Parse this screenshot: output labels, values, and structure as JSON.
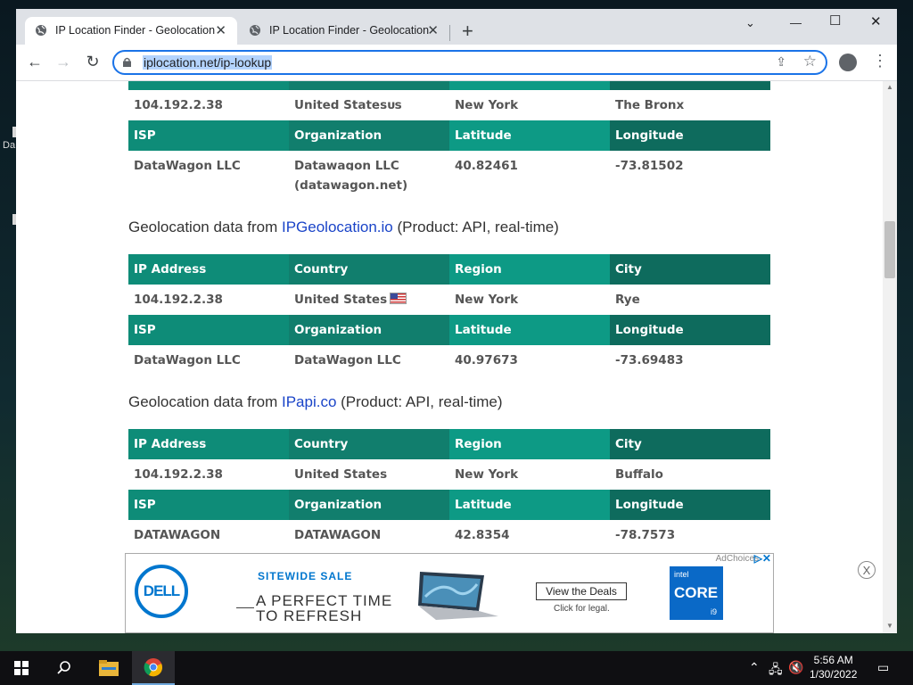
{
  "desktop": {
    "icon_text": "Da"
  },
  "browser": {
    "tabs": [
      {
        "title": "IP Location Finder - Geolocation",
        "active": true
      },
      {
        "title": "IP Location Finder - Geolocation",
        "active": false
      }
    ],
    "new_tab_label": "+",
    "window_controls": {
      "minimize": "﹀",
      "maximize": "—",
      "restore": "☐",
      "close": "✕"
    },
    "url": "iplocation.net/ip-lookup"
  },
  "content": {
    "top_partial": {
      "values": [
        "104.192.2.38",
        "United Statesᴜs",
        "New York",
        "The Bronx"
      ],
      "isp_headers": [
        "ISP",
        "Organization",
        "Latitude",
        "Longitude"
      ],
      "isp_values": [
        "DataWagon LLC",
        "Datawagon LLC",
        "40.82461",
        "-73.81502"
      ],
      "isp_values_line2": "(datawagon.net)"
    },
    "sections": [
      {
        "heading_prefix": "Geolocation data from ",
        "link": "IPGeolocation.io",
        "heading_suffix": " (Product: API, real-time)",
        "headers": [
          "IP Address",
          "Country",
          "Region",
          "City"
        ],
        "values": [
          "104.192.2.38",
          "United States",
          "New York",
          "Rye"
        ],
        "isp_headers": [
          "ISP",
          "Organization",
          "Latitude",
          "Longitude"
        ],
        "isp_values": [
          "DataWagon LLC",
          "DataWagon LLC",
          "40.97673",
          "-73.69483"
        ]
      },
      {
        "heading_prefix": "Geolocation data from ",
        "link": "IPapi.co",
        "heading_suffix": " (Product: API, real-time)",
        "headers": [
          "IP Address",
          "Country",
          "Region",
          "City"
        ],
        "values": [
          "104.192.2.38",
          "United States",
          "New York",
          "Buffalo"
        ],
        "isp_headers": [
          "ISP",
          "Organization",
          "Latitude",
          "Longitude"
        ],
        "isp_values": [
          "DATAWAGON",
          "DATAWAGON",
          "42.8354",
          "-78.7573"
        ]
      }
    ]
  },
  "ad": {
    "brand": "DELL",
    "sale": "SITEWIDE SALE",
    "tagline_1": "A PERFECT TIME",
    "tagline_2": "TO REFRESH",
    "cta": "View the Deals",
    "legal": "Click for legal.",
    "intel_1": "intel",
    "intel_2": "CORE",
    "intel_3": "i9",
    "adchoices": "AdChoices",
    "close": "X"
  },
  "taskbar": {
    "time": "5:56 AM",
    "date": "1/30/2022"
  },
  "colors": {
    "header_teal": "#0e8c78",
    "link_blue": "#1a44c8",
    "dell_blue": "#0076ce"
  }
}
